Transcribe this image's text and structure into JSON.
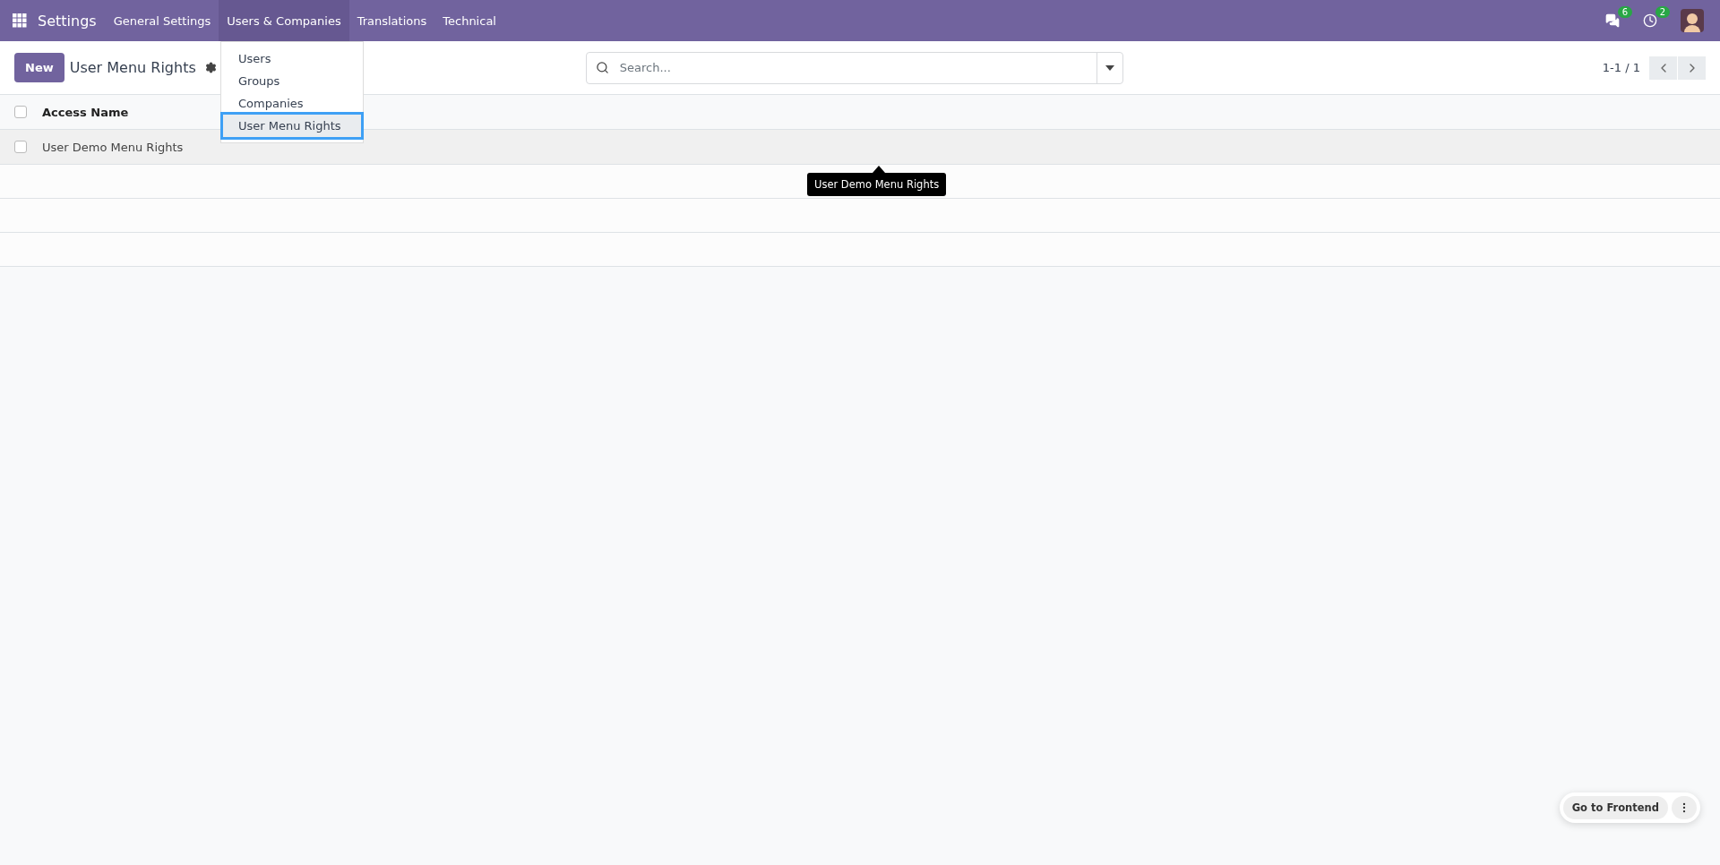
{
  "navbar": {
    "app_title": "Settings",
    "menus": [
      {
        "label": "General Settings",
        "selected": false
      },
      {
        "label": "Users & Companies",
        "selected": true
      },
      {
        "label": "Translations",
        "selected": false
      },
      {
        "label": "Technical",
        "selected": false
      }
    ],
    "messages_badge": "6",
    "activities_badge": "2"
  },
  "dropdown": {
    "items": [
      {
        "label": "Users",
        "selected": false
      },
      {
        "label": "Groups",
        "selected": false
      },
      {
        "label": "Companies",
        "selected": false
      },
      {
        "label": "User Menu Rights",
        "selected": true
      }
    ]
  },
  "control_panel": {
    "new_button": "New",
    "title": "User Menu Rights",
    "search": {
      "placeholder": "Search..."
    },
    "pager": "1-1 / 1"
  },
  "table": {
    "select_all_checked": false,
    "columns": [
      "Access Name"
    ],
    "rows": [
      {
        "cells": [
          "User Demo Menu Rights"
        ],
        "checked": false,
        "hovered": true
      }
    ]
  },
  "tooltip": "User Demo Menu Rights",
  "floating": {
    "button": "Go to Frontend"
  }
}
